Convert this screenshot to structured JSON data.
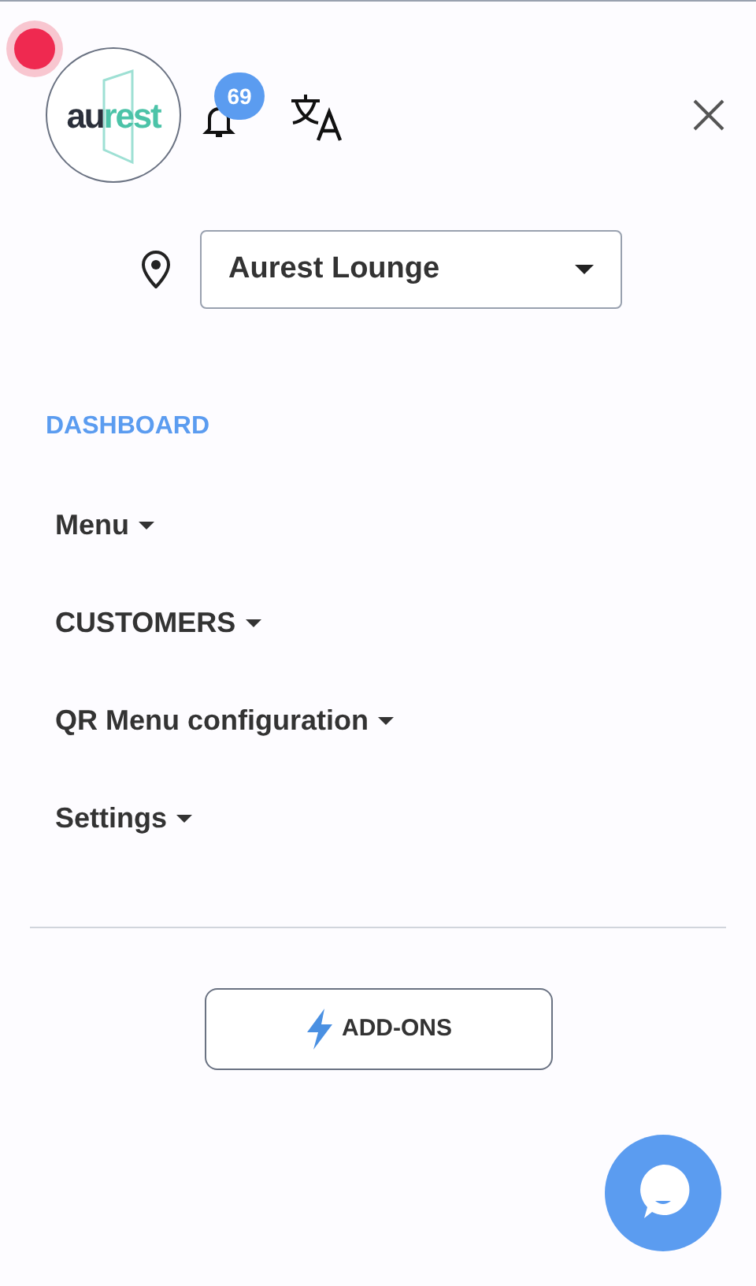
{
  "header": {
    "logo": {
      "part_1": "au",
      "part_2": "rest"
    },
    "notification_count": "69"
  },
  "location": {
    "value": "Aurest Lounge"
  },
  "nav": [
    {
      "label": "DASHBOARD",
      "selected": true,
      "has_submenu": false
    },
    {
      "label": "Menu",
      "selected": false,
      "has_submenu": true
    },
    {
      "label": "CUSTOMERS",
      "selected": false,
      "has_submenu": true
    },
    {
      "label": "QR Menu configuration",
      "selected": false,
      "has_submenu": true
    },
    {
      "label": "Settings",
      "selected": false,
      "has_submenu": true
    }
  ],
  "addons_button": {
    "label": "ADD-ONS"
  }
}
